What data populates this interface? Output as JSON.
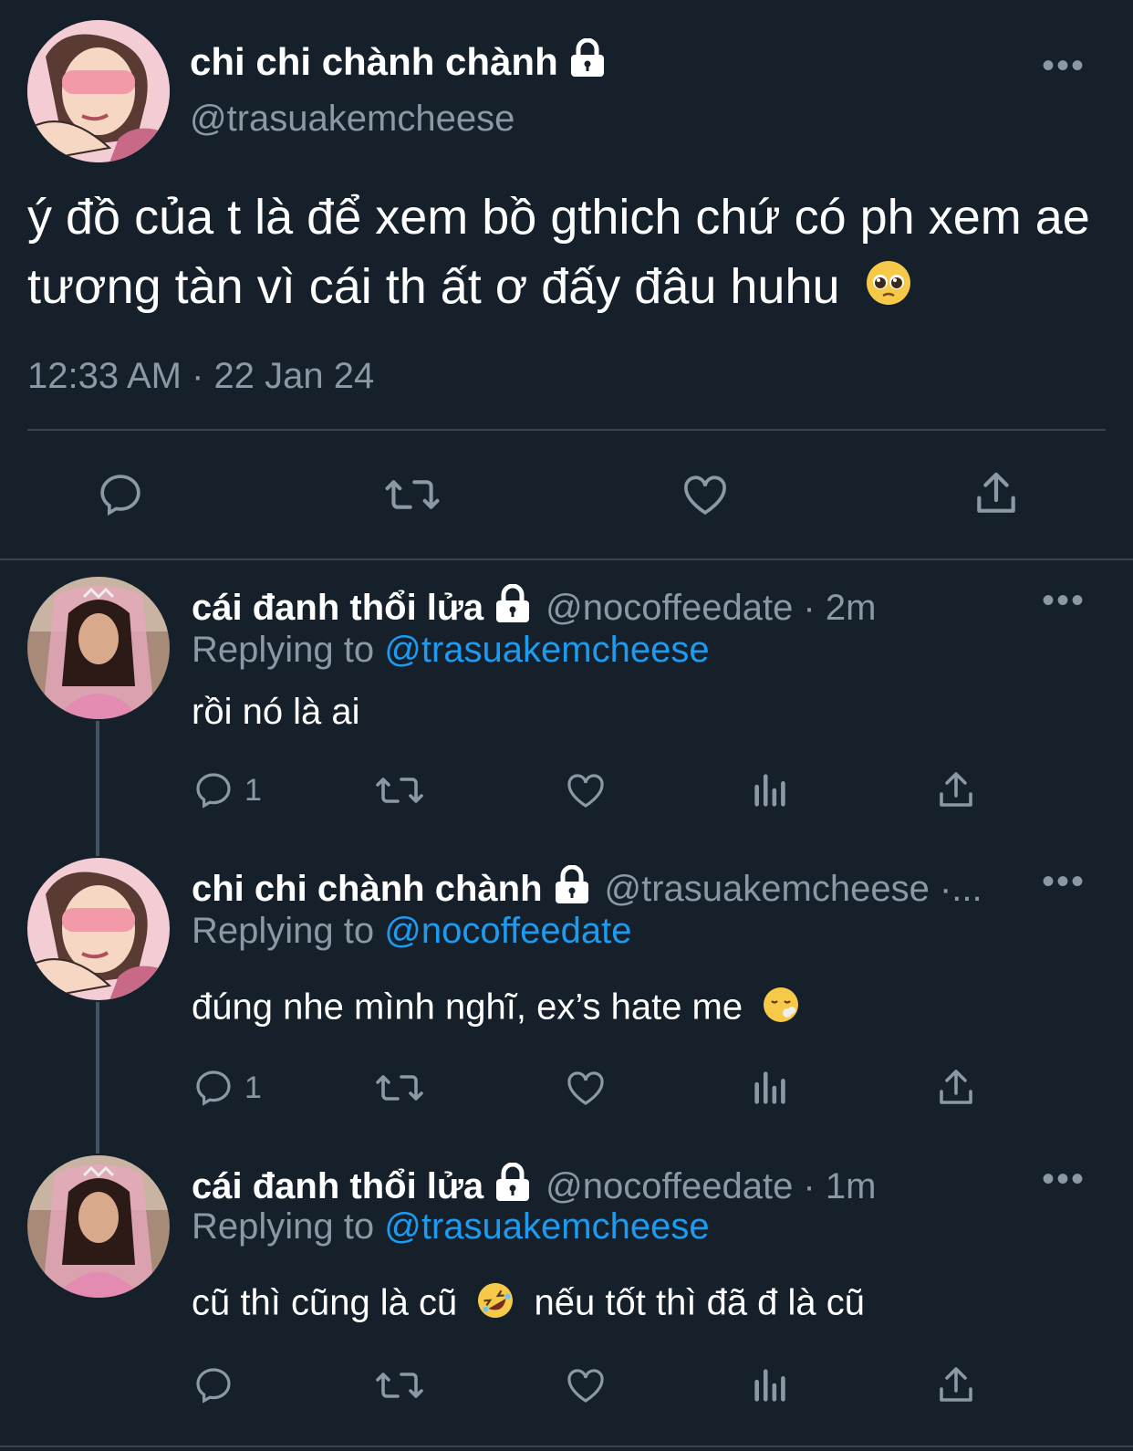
{
  "main_tweet": {
    "display_name": "chi chi chành chành",
    "handle": "@trasuakemcheese",
    "text": "ý đồ của t là để xem bồ gthich chứ có ph xem ae tương tàn vì cái th ất ơ đấy đâu huhu",
    "emoji": "pleading-face",
    "timestamp": "12:33 AM · 22 Jan 24",
    "more": "•••"
  },
  "replies": [
    {
      "display_name": "cái đanh thổi lửa",
      "handle": "@nocoffeedate · 2m",
      "replying_prefix": "Replying to",
      "replying_to": "@trasuakemcheese",
      "text": "rồi nó là ai",
      "reply_count": "1",
      "more": "•••"
    },
    {
      "display_name": "chi chi chành chành",
      "handle": "@trasuakemcheese ·...",
      "replying_prefix": "Replying to",
      "replying_to": "@nocoffeedate",
      "text": "đúng nhe mình nghĩ, ex’s hate me",
      "emoji": "face-exhaling",
      "reply_count": "1",
      "more": "•••"
    },
    {
      "display_name": "cái đanh thổi lửa",
      "handle": "@nocoffeedate · 1m",
      "replying_prefix": "Replying to",
      "replying_to": "@trasuakemcheese",
      "text_before": "cũ thì cũng là cũ",
      "emoji": "rolling-on-floor-laughing",
      "text_after": "nếu tốt thì đã đ là cũ",
      "reply_count": "",
      "more": "•••"
    }
  ],
  "colors": {
    "background": "#15202b",
    "muted": "#8b98a5",
    "link": "#1d9bf0",
    "divider": "#38444d"
  }
}
